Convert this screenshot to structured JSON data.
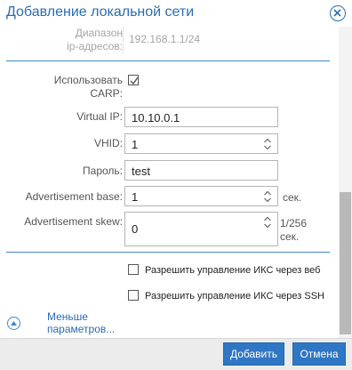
{
  "dialog": {
    "title": "Добавление локальной сети",
    "close_icon": "close-circle-icon"
  },
  "form": {
    "ip_range": {
      "label_line1": "Диапазон",
      "label_line2": "ip-адресов:",
      "value": "192.168.1.1/24"
    },
    "use_carp": {
      "label_line1": "Использовать",
      "label_line2": "CARP:",
      "checked": true
    },
    "virtual_ip": {
      "label": "Virtual IP:",
      "value": "10.10.0.1"
    },
    "vhid": {
      "label": "VHID:",
      "value": "1"
    },
    "password": {
      "label": "Пароль:",
      "value": "test"
    },
    "adv_base": {
      "label": "Advertisement base:",
      "value": "1",
      "suffix": "сек."
    },
    "adv_skew": {
      "label": "Advertisement skew:",
      "value": "0",
      "suffix_line1": "1/256",
      "suffix_line2": "сек."
    },
    "allow_web": {
      "label": "Разрешить управление ИКС через веб",
      "checked": false
    },
    "allow_ssh": {
      "label": "Разрешить управление ИКС через SSH",
      "checked": false
    }
  },
  "less_link": {
    "line1": "Меньше",
    "line2": "параметров...",
    "icon": "chevron-up-circle-icon"
  },
  "footer": {
    "add_label": "Добавить",
    "cancel_label": "Отмена"
  },
  "colors": {
    "accent": "#2a6db0",
    "button": "#2f77c4",
    "separator": "#3f88cc"
  }
}
